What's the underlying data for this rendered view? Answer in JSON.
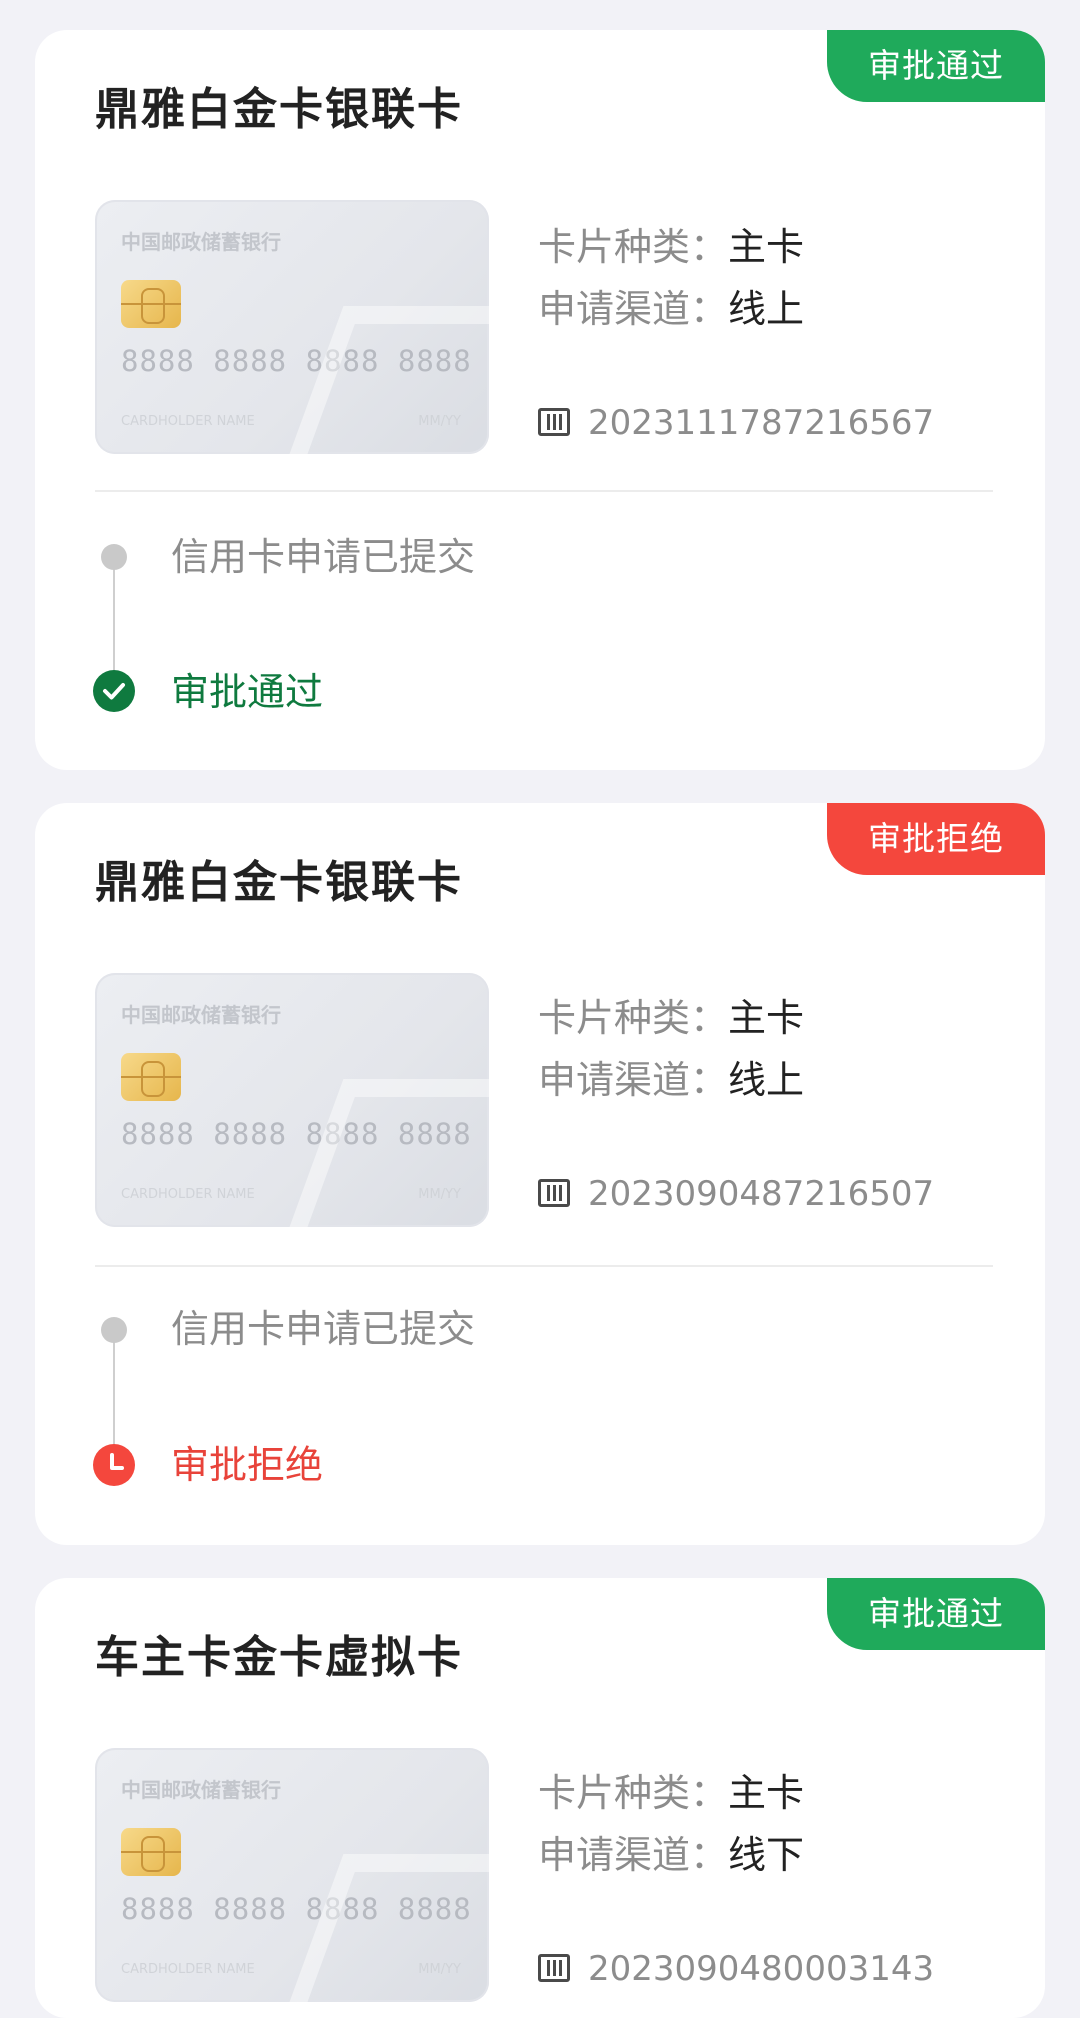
{
  "applications": [
    {
      "status_badge": "审批通过",
      "title": "鼎雅白金卡银联卡",
      "card_image": {
        "bank_name": "中国邮政储蓄银行",
        "number": "8888 8888 8888 8888",
        "holder_label": "CARDHOLDER NAME",
        "expiry_label": "MM/YY"
      },
      "card_type_label": "卡片种类：",
      "card_type_value": "主卡",
      "channel_label": "申请渠道：",
      "channel_value": "线上",
      "application_number": "2023111787216567",
      "timeline": [
        {
          "text": "信用卡申请已提交",
          "state": "done"
        },
        {
          "text": "审批通过",
          "state": "approved"
        }
      ]
    },
    {
      "status_badge": "审批拒绝",
      "title": "鼎雅白金卡银联卡",
      "card_image": {
        "bank_name": "中国邮政储蓄银行",
        "number": "8888 8888 8888 8888",
        "holder_label": "CARDHOLDER NAME",
        "expiry_label": "MM/YY"
      },
      "card_type_label": "卡片种类：",
      "card_type_value": "主卡",
      "channel_label": "申请渠道：",
      "channel_value": "线上",
      "application_number": "2023090487216507",
      "timeline": [
        {
          "text": "信用卡申请已提交",
          "state": "done"
        },
        {
          "text": "审批拒绝",
          "state": "rejected"
        }
      ]
    },
    {
      "status_badge": "审批通过",
      "title": "车主卡金卡虚拟卡",
      "card_image": {
        "bank_name": "中国邮政储蓄银行",
        "number": "8888 8888 8888 8888",
        "holder_label": "CARDHOLDER NAME",
        "expiry_label": "MM/YY"
      },
      "card_type_label": "卡片种类：",
      "card_type_value": "主卡",
      "channel_label": "申请渠道：",
      "channel_value": "线下",
      "application_number": "2023090480003143"
    }
  ],
  "colors": {
    "approved": "#1faa5b",
    "approved_text": "#0f7a3f",
    "rejected": "#f4473d",
    "background": "#f2f2f7"
  },
  "icons": [
    "barcode-icon",
    "check-circle-icon",
    "clock-icon",
    "timeline-dot-icon"
  ]
}
